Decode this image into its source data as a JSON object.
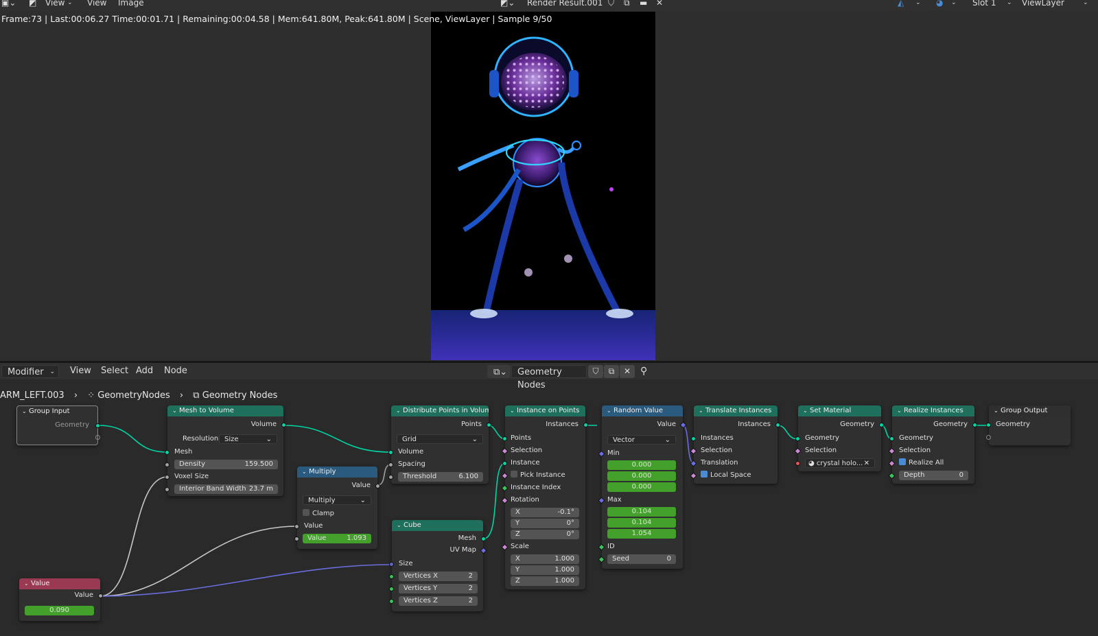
{
  "top": {
    "view1": "View",
    "view2": "View",
    "image": "Image",
    "image_name": "Render Result.001",
    "slot": "Slot 1",
    "layer": "ViewLayer"
  },
  "render_info": "Frame:73 | Last:00:06.27 Time:00:01.71 | Remaining:00:04.58 | Mem:641.80M, Peak:641.80M | Scene, ViewLayer | Sample 9/50",
  "editor": {
    "mode": "Modifier",
    "menu": [
      "View",
      "Select",
      "Add",
      "Node"
    ],
    "tree_name": "Geometry Nodes"
  },
  "breadcrumb": {
    "object": "ARM_LEFT.003",
    "modifier": "GeometryNodes",
    "tree": "Geometry Nodes"
  },
  "nodes": {
    "group_input": {
      "title": "Group Input",
      "out": "Geometry"
    },
    "mesh_to_volume": {
      "title": "Mesh to Volume",
      "out": "Volume",
      "res_label": "Resolution",
      "res_value": "Size",
      "mesh": "Mesh",
      "density": "Density",
      "density_value": "159.500",
      "voxel": "Voxel Size",
      "band": "Interior Band Width",
      "band_value": "23.7 m"
    },
    "multiply": {
      "title": "Multiply",
      "out": "Value",
      "op": "Multiply",
      "clamp": "Clamp",
      "in1": "Value",
      "in2": "Value",
      "in2_value": "1.093"
    },
    "distribute": {
      "title": "Distribute Points in Volume",
      "out": "Points",
      "mode": "Grid",
      "volume": "Volume",
      "spacing": "Spacing",
      "threshold": "Threshold",
      "threshold_value": "6.100"
    },
    "cube": {
      "title": "Cube",
      "mesh": "Mesh",
      "uv": "UV Map",
      "size": "Size",
      "vx": "Vertices X",
      "vx_value": "2",
      "vy": "Vertices Y",
      "vy_value": "2",
      "vz": "Vertices Z",
      "vz_value": "2"
    },
    "instance": {
      "title": "Instance on Points",
      "out": "Instances",
      "points": "Points",
      "selection": "Selection",
      "instance": "Instance",
      "pick": "Pick Instance",
      "index": "Instance Index",
      "rotation": "Rotation",
      "rx": "X",
      "rx_value": "-0.1°",
      "ry": "Y",
      "ry_value": "0°",
      "rz": "Z",
      "rz_value": "0°",
      "scale": "Scale",
      "sx": "X",
      "sx_value": "1.000",
      "sy": "Y",
      "sy_value": "1.000",
      "sz": "Z",
      "sz_value": "1.000"
    },
    "random": {
      "title": "Random Value",
      "out": "Value",
      "type": "Vector",
      "min": "Min",
      "min_x": "0.000",
      "min_y": "0.000",
      "min_z": "0.000",
      "max": "Max",
      "max_x": "0.104",
      "max_y": "0.104",
      "max_z": "1.054",
      "id": "ID",
      "seed": "Seed",
      "seed_value": "0"
    },
    "translate": {
      "title": "Translate Instances",
      "out": "Instances",
      "instances": "Instances",
      "selection": "Selection",
      "translation": "Translation",
      "local": "Local Space"
    },
    "set_material": {
      "title": "Set Material",
      "out": "Geometry",
      "geometry": "Geometry",
      "selection": "Selection",
      "material": "crystal holo..."
    },
    "realize": {
      "title": "Realize Instances",
      "out": "Geometry",
      "geometry": "Geometry",
      "selection": "Selection",
      "realize_all": "Realize All",
      "depth": "Depth",
      "depth_value": "0"
    },
    "group_output": {
      "title": "Group Output",
      "in": "Geometry"
    },
    "value": {
      "title": "Value",
      "out": "Value",
      "value": "0.090"
    }
  },
  "colors": {
    "geometry_socket": "#00d6a3",
    "vector_socket": "#6363c7",
    "float_socket": "#a1a1a1",
    "field_socket": "#cc8ad6",
    "header_geometry": "#1e6f5c",
    "header_math": "#2a5a7e",
    "header_input": "#9a3a52",
    "value_field": "#43a02a"
  }
}
